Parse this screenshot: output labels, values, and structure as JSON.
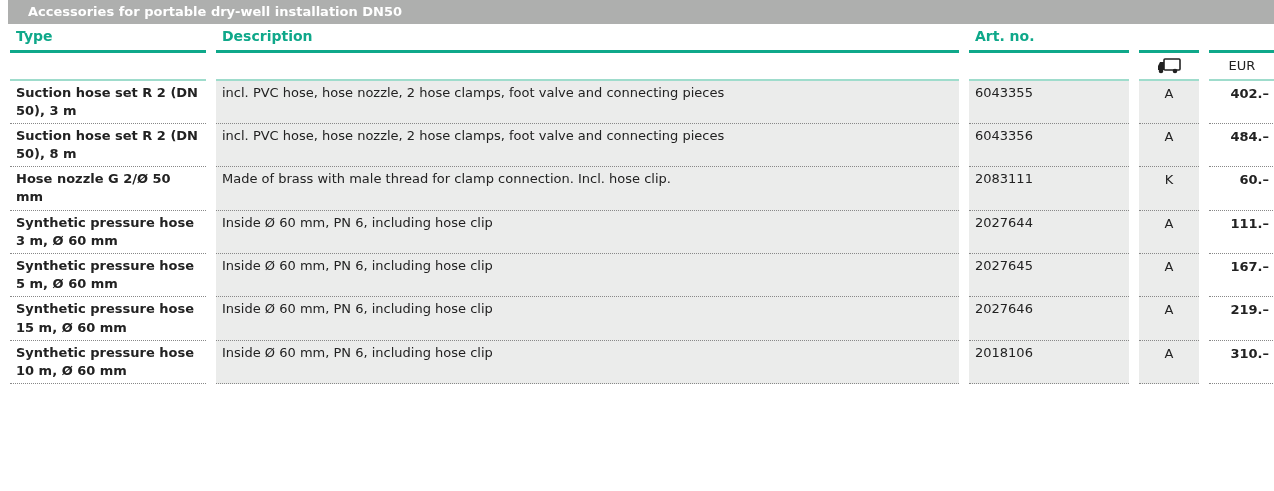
{
  "title": "Accessories for portable dry-well installation DN50",
  "columns": [
    "Type",
    "Description",
    "Art. no."
  ],
  "subheader": {
    "currency": "EUR"
  },
  "rows": [
    {
      "type": "Suction hose set R 2 (DN 50), 3 m",
      "description": "incl. PVC hose, hose nozzle, 2 hose clamps, foot valve and connecting pieces",
      "art_no": "6043355",
      "delivery": "A",
      "price": "402.–"
    },
    {
      "type": "Suction hose set R 2 (DN 50), 8 m",
      "description": "incl. PVC hose, hose nozzle, 2 hose clamps, foot valve and connecting pieces",
      "art_no": "6043356",
      "delivery": "A",
      "price": "484.–"
    },
    {
      "type": "Hose nozzle G 2/Ø 50 mm",
      "description": "Made of brass with male thread for clamp connection. Incl. hose clip.",
      "art_no": "2083111",
      "delivery": "K",
      "price": "60.–"
    },
    {
      "type": "Synthetic pressure hose 3 m, Ø 60 mm",
      "description": "Inside Ø 60 mm, PN 6, including hose clip",
      "art_no": "2027644",
      "delivery": "A",
      "price": "111.–"
    },
    {
      "type": "Synthetic pressure hose 5 m, Ø 60 mm",
      "description": "Inside Ø 60 mm, PN 6, including hose clip",
      "art_no": "2027645",
      "delivery": "A",
      "price": "167.–"
    },
    {
      "type": "Synthetic pressure hose 15 m, Ø 60 mm",
      "description": "Inside Ø 60 mm, PN 6, including hose clip",
      "art_no": "2027646",
      "delivery": "A",
      "price": "219.–"
    },
    {
      "type": "Synthetic pressure hose 10 m, Ø 60 mm",
      "description": "Inside Ø 60 mm, PN 6, including hose clip",
      "art_no": "2018106",
      "delivery": "A",
      "price": "310.–"
    }
  ]
}
